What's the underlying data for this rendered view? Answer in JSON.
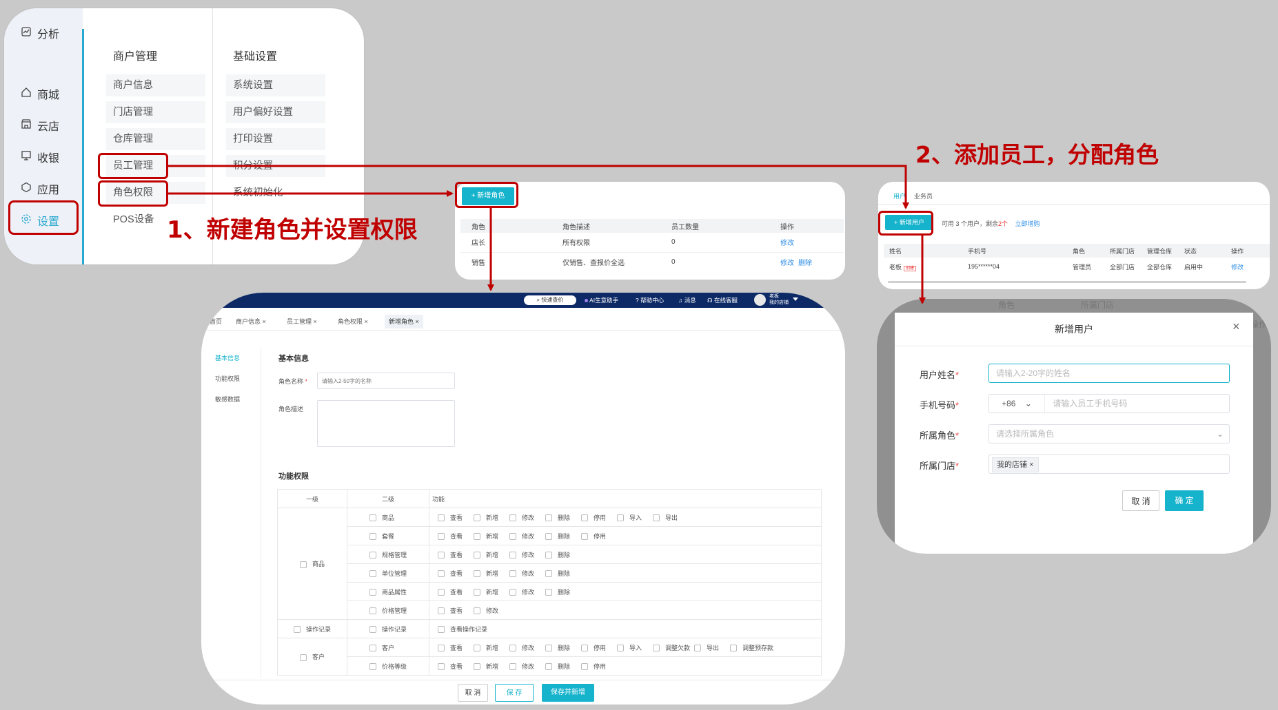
{
  "settings_panel": {
    "sidebar": [
      {
        "label": "分析",
        "icon": "chart-icon"
      },
      {
        "label": "商城",
        "icon": "home-icon"
      },
      {
        "label": "云店",
        "icon": "store-icon"
      },
      {
        "label": "收银",
        "icon": "monitor-icon"
      },
      {
        "label": "应用",
        "icon": "hexagon-icon"
      },
      {
        "label": "设置",
        "icon": "gear-icon"
      }
    ],
    "col1_title": "商户管理",
    "col1_items": [
      "商户信息",
      "门店管理",
      "仓库管理",
      "员工管理",
      "角色权限",
      "POS设备"
    ],
    "col2_title": "基础设置",
    "col2_items": [
      "系统设置",
      "用户偏好设置",
      "打印设置",
      "积分设置",
      "系统初始化"
    ]
  },
  "step1_label": "1、新建角色并设置权限",
  "step2_label": "2、添加员工，分配角色",
  "role_list": {
    "add_button": "+ 新增角色",
    "headers": [
      "角色",
      "角色描述",
      "员工数量",
      "操作"
    ],
    "rows": [
      {
        "role": "店长",
        "desc": "所有权限",
        "count": "0",
        "actions": [
          "修改"
        ]
      },
      {
        "role": "销售",
        "desc": "仅销售、查报价全选",
        "count": "0",
        "actions": [
          "修改",
          "删除"
        ]
      }
    ]
  },
  "user_list": {
    "tabs": [
      "用户",
      "业务员"
    ],
    "add_button": "+ 新增用户",
    "quota_text_1": "可用 3 个用户，剩余",
    "quota_remaining": "2个",
    "buy_link": "立即增购",
    "headers": [
      "姓名",
      "手机号",
      "角色",
      "所属门店",
      "管理仓库",
      "状态",
      "操作"
    ],
    "row": {
      "name": "老板",
      "badge": "创建",
      "phone": "195******04",
      "role": "管理员",
      "store": "全部门店",
      "warehouse": "全部仓库",
      "status": "启用中",
      "action": "修改"
    },
    "behind_labels": [
      "角色",
      "所属门店"
    ],
    "behind_right": "操作"
  },
  "role_form": {
    "topbar": {
      "search": "快速查价",
      "ai": "AI生意助手",
      "help": "帮助中心",
      "msg": "消息",
      "service": "在线客服",
      "user": "老板",
      "user_sub": "我的店铺"
    },
    "tabs": [
      "首页",
      "商户信息",
      "员工管理",
      "角色权限",
      "新增角色"
    ],
    "side_nav": [
      "基本信息",
      "功能权限",
      "敏感数据"
    ],
    "basic_title": "基本信息",
    "name_label": "角色名称",
    "name_placeholder": "请输入2-50字的名称",
    "desc_label": "角色描述",
    "perm_title": "功能权限",
    "perm_headers": [
      "一级",
      "二级",
      "功能"
    ],
    "groups": [
      {
        "name": "商品",
        "rows": [
          {
            "sub": "商品",
            "fns": [
              "查看",
              "新增",
              "修改",
              "删除",
              "停用",
              "导入",
              "导出"
            ]
          },
          {
            "sub": "套餐",
            "fns": [
              "查看",
              "新增",
              "修改",
              "删除",
              "停用"
            ]
          },
          {
            "sub": "规格管理",
            "fns": [
              "查看",
              "新增",
              "修改",
              "删除"
            ]
          },
          {
            "sub": "单位管理",
            "fns": [
              "查看",
              "新增",
              "修改",
              "删除"
            ]
          },
          {
            "sub": "商品属性",
            "fns": [
              "查看",
              "新增",
              "修改",
              "删除"
            ]
          },
          {
            "sub": "价格管理",
            "fns": [
              "查看",
              "修改"
            ]
          }
        ]
      },
      {
        "name": "操作记录",
        "rows": [
          {
            "sub": "操作记录",
            "fns": [
              "查看操作记录"
            ]
          }
        ]
      },
      {
        "name": "客户",
        "rows": [
          {
            "sub": "客户",
            "fns": [
              "查看",
              "新增",
              "修改",
              "删除",
              "停用",
              "导入",
              "调整欠款",
              "导出",
              "调整预存款"
            ]
          },
          {
            "sub": "价格等级",
            "fns": [
              "查看",
              "新增",
              "修改",
              "删除",
              "停用"
            ]
          }
        ]
      }
    ],
    "buttons": {
      "cancel": "取 消",
      "save": "保 存",
      "save_new": "保存并新增"
    }
  },
  "user_dialog": {
    "title": "新增用户",
    "name_label": "用户姓名",
    "name_placeholder": "请输入2-20字的姓名",
    "phone_label": "手机号码",
    "phone_code": "+86",
    "phone_placeholder": "请输入员工手机号码",
    "role_label": "所属角色",
    "role_placeholder": "请选择所属角色",
    "store_label": "所属门店",
    "store_tag": "我的店铺",
    "cancel": "取 消",
    "confirm": "确 定"
  },
  "colors": {
    "accent": "#16b3cc",
    "red": "#c00000",
    "link": "#2a8be6",
    "navy": "#0d2a66"
  }
}
